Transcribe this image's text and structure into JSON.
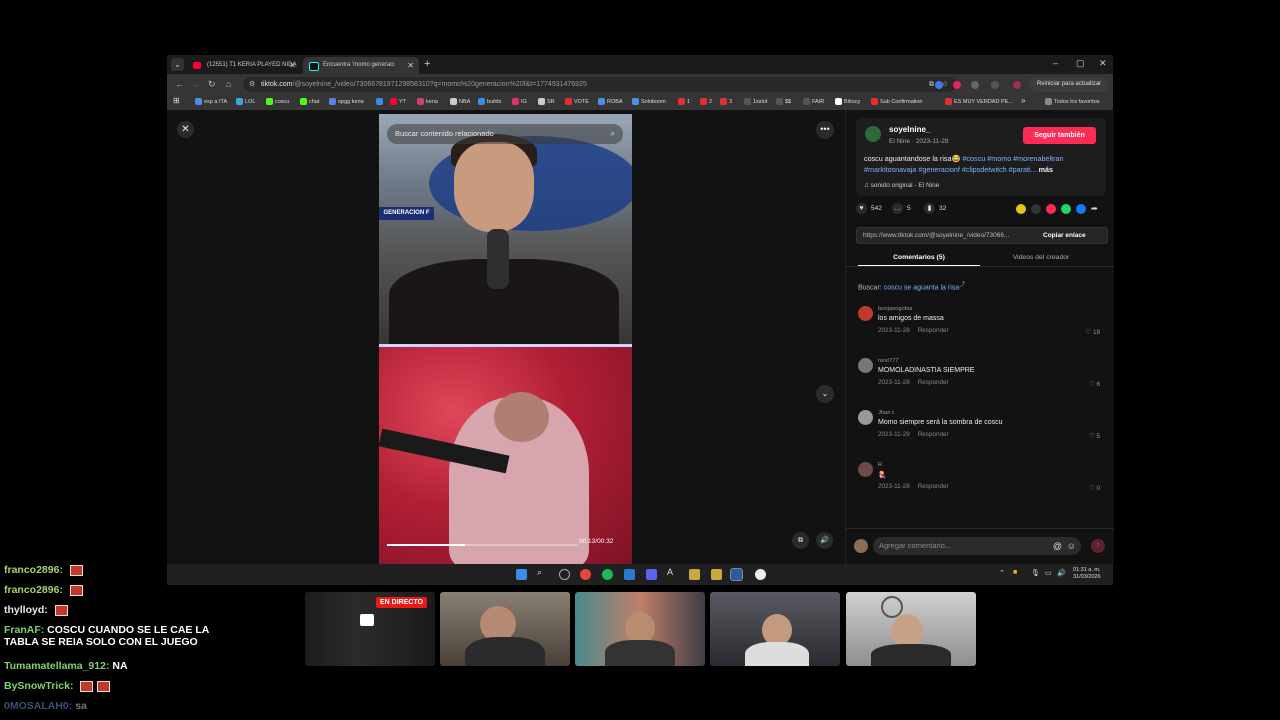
{
  "browser": {
    "tabs": [
      {
        "label": "(12551) T1 KERIA PLAYED NIDA",
        "active": false
      },
      {
        "label": "Encuentra 'momo generaci",
        "active": true
      }
    ],
    "new_tab": "+",
    "window_controls": [
      "–",
      "▢",
      "✕"
    ],
    "url_domain": "tiktok.com",
    "url_path": "/@soyelnine_/video/7306678197129858310?q=momo%20generacion%20f&t=1774931476925",
    "restart_label": "Reiniciar para actualizar",
    "bookmarks": [
      {
        "label": "esp a ITA",
        "color": "#4a8fe8"
      },
      {
        "label": "LOL",
        "color": "#3aa8e0"
      },
      {
        "label": "coscu",
        "color": "#53fc18"
      },
      {
        "label": "chat",
        "color": "#53fc18"
      },
      {
        "label": "opgg keria",
        "color": "#5383e8"
      },
      {
        "label": "",
        "color": "#3a8ee6"
      },
      {
        "label": "YT",
        "color": "#ff0033"
      },
      {
        "label": "keria",
        "color": "#d13b7a"
      },
      {
        "label": "NBA",
        "color": "#cccccc"
      },
      {
        "label": "builds",
        "color": "#3a8ee6"
      },
      {
        "label": "IG",
        "color": "#e1306c"
      },
      {
        "label": "SR",
        "color": "#cccccc"
      },
      {
        "label": "VOTE",
        "color": "#e03030"
      },
      {
        "label": "ROBA",
        "color": "#4a8fe8"
      },
      {
        "label": "Soloboom",
        "color": "#4a8fe8"
      },
      {
        "label": "1",
        "color": "#e03030"
      },
      {
        "label": "2",
        "color": "#e03030"
      },
      {
        "label": "3",
        "color": "#e03030"
      },
      {
        "label": "1xslot",
        "color": "#555555"
      },
      {
        "label": "$$",
        "color": "#555555"
      },
      {
        "label": "FAIR",
        "color": "#555555"
      },
      {
        "label": "Bitiucy",
        "color": "#ffffff"
      },
      {
        "label": "Sub Confirmation",
        "color": "#e03030"
      },
      {
        "label": "ES MUY VERDAD PE...",
        "color": "#e03030"
      }
    ],
    "bookmarks_more": "»",
    "all_bookmarks": "Todos los favoritos"
  },
  "video": {
    "search_placeholder": "Buscar contenido relacionado",
    "banner_label": "GENERACION F",
    "time": "00:13/00:32",
    "progress": 0.41
  },
  "creator": {
    "username": "soyelnine_",
    "subtitle": "El Nine · 2023-11-28",
    "follow_label": "Seguir también",
    "description_text": "coscu aguantandose la risa😂 ",
    "hashtags": "#coscu #momo #morenabeltran #markitosnavaja #generacionf #clipsdetwitch #parati...",
    "more_label": "más",
    "sound": "♫ sonido original - El Nine"
  },
  "stats": {
    "likes": "542",
    "comments": "5",
    "saves": "32"
  },
  "link": {
    "url": "https://www.tiktok.com/@soyelnine_/video/73066...",
    "copy_label": "Copiar enlace"
  },
  "tabs": {
    "comments": "Comentarios (5)",
    "creator_videos": "Videos del creador"
  },
  "search_hint": {
    "prefix": "Buscar: ",
    "query": "coscu se aguanta la risa"
  },
  "comments": [
    {
      "user": "bonjasogobia",
      "text": "los amigos de massa",
      "date": "2023-11-28",
      "reply": "Responder",
      "likes": "18"
    },
    {
      "user": "nest777",
      "text": "MOMOLADINASTIA SIEMPRE",
      "date": "2023-11-28",
      "reply": "Responder",
      "likes": "6"
    },
    {
      "user": "Jhan t.",
      "text": "Momo siempre será la sombra de coscu",
      "date": "2023-11-29",
      "reply": "Responder",
      "likes": "5"
    },
    {
      "user": "R",
      "text": "🪼",
      "date": "2023-11-28",
      "reply": "Responder",
      "likes": "0"
    }
  ],
  "comment_input": {
    "placeholder": "Agregar comentario..."
  },
  "taskbar": {
    "time": "01:31 a. m.",
    "date": "31/03/2026"
  },
  "chat": [
    {
      "user": "franco2896:",
      "text": "",
      "color": "#a7d36b",
      "badge": true
    },
    {
      "user": "franco2896:",
      "text": "",
      "color": "#a7d36b",
      "badge": true
    },
    {
      "user": "thylloyd:",
      "text": "",
      "color": "#e8e8e8",
      "badge": true
    },
    {
      "user": "FranAF:",
      "text": "COSCU CUANDO SE LE CAE LA",
      "text2": "TABLA SE REIA SOLO CON EL JUEGO",
      "color": "#7fd36b",
      "badge": false
    },
    {
      "user": "Tumamatellama_912:",
      "text": "NA",
      "color": "#7fd36b",
      "badge": false
    },
    {
      "user": "BySnowTrick:",
      "text": "",
      "color": "#7fd36b",
      "badge": true
    },
    {
      "user": "0MOSALAH0:",
      "text": "sa",
      "color": "#7fb0ff",
      "badge": false
    }
  ],
  "cams": {
    "live_label": "EN DIRECTO"
  }
}
